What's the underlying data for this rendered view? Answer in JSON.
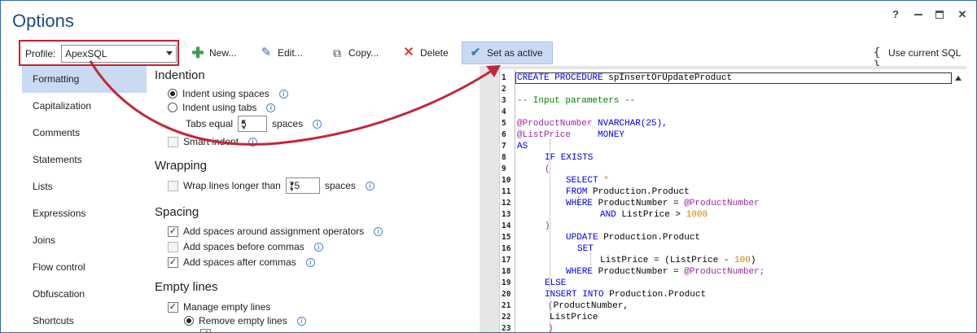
{
  "window": {
    "title": "Options",
    "help": "?"
  },
  "toolbar": {
    "profile_label": "Profile:",
    "profile_value": "ApexSQL",
    "new_label": "New...",
    "edit_label": "Edit...",
    "copy_label": "Copy...",
    "delete_label": "Delete",
    "set_active_label": "Set as active",
    "use_sql_label": "Use current SQL",
    "use_sql_icon": "{ }"
  },
  "sidebar": {
    "items": [
      "Formatting",
      "Capitalization",
      "Comments",
      "Statements",
      "Lists",
      "Expressions",
      "Joins",
      "Flow control",
      "Obfuscation",
      "Shortcuts"
    ],
    "selected": "Formatting"
  },
  "indention": {
    "title": "Indention",
    "indent_spaces": "Indent using spaces",
    "indent_tabs": "Indent using tabs",
    "tabs_equal": "Tabs equal",
    "tabs_value": "5",
    "spaces": "spaces",
    "smart_indent": "Smart indent"
  },
  "wrapping": {
    "title": "Wrapping",
    "wrap_label": "Wrap lines longer than",
    "wrap_value": "75",
    "spaces": "spaces"
  },
  "spacing": {
    "title": "Spacing",
    "assign_ops": "Add spaces around assignment operators",
    "before_commas": "Add spaces before commas",
    "after_commas": "Add spaces after commas"
  },
  "empty_lines": {
    "title": "Empty lines",
    "manage": "Manage empty lines",
    "remove": "Remove empty lines"
  },
  "editor": {
    "line_numbers": [
      "1",
      "2",
      "3",
      "4",
      "5",
      "6",
      "7",
      "8",
      "9",
      "10",
      "11",
      "12",
      "13",
      "14",
      "15",
      "16",
      "17",
      "18",
      "19",
      "20",
      "21",
      "22",
      "23"
    ],
    "l1a": "CREATE PROCEDURE",
    "l1b": " spInsertOrUpdateProduct",
    "l3": "-- Input parameters --",
    "l5a": "@ProductNumber",
    "l5b": " NVARCHAR(25),",
    "l6a": "@ListPrice",
    "l6b": "     MONEY",
    "l7": "AS",
    "l8": "IF EXISTS",
    "l9": "(",
    "l10a": "SELECT",
    "l10b": " *",
    "l11a": "FROM",
    "l11b": " Production.Product",
    "l12a": "WHERE",
    "l12b": " ProductNumber = ",
    "l12c": "@ProductNumber",
    "l13a": "AND",
    "l13b": " ListPrice > ",
    "l13c": "1000",
    "l14": ")",
    "l15a": "UPDATE",
    "l15b": " Production.Product",
    "l16": "SET",
    "l17a": "ListPrice = (ListPrice - ",
    "l17b": "100",
    "l17c": ")",
    "l18a": "WHERE",
    "l18b": " ProductNumber = ",
    "l18c": "@ProductNumber;",
    "l19": "ELSE",
    "l20a": "INSERT INTO",
    "l20b": " Production.Product",
    "l21a": "(",
    "l21b": "ProductNumber,",
    "l22": "ListPrice",
    "l23": ")"
  },
  "colors": {
    "accent": "#1c4e80",
    "selection": "#c9daf2",
    "highlight_border": "#cc1f2f",
    "arrow": "#c0283a"
  }
}
